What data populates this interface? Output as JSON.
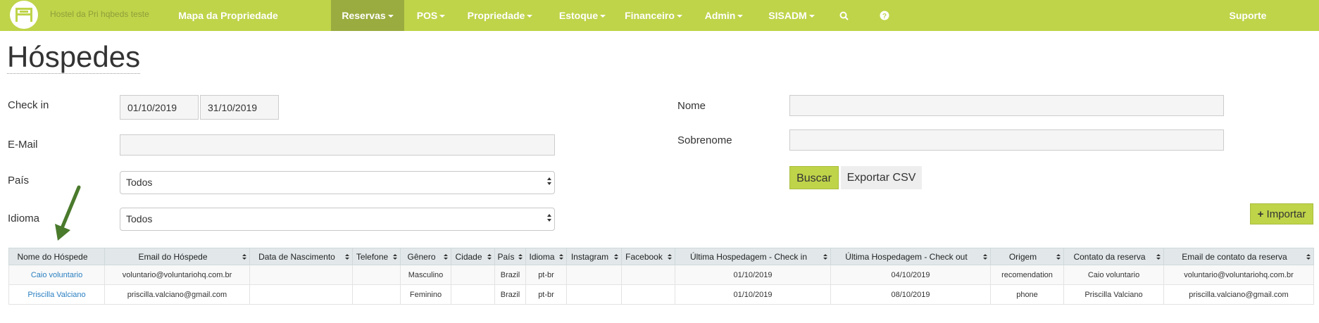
{
  "navbar": {
    "brand": "Hostel da Pri hqbeds teste",
    "items": [
      {
        "label": "Mapa da Propriedade",
        "dropdown": false,
        "active": false
      },
      {
        "label": "Reservas",
        "dropdown": true,
        "active": true
      },
      {
        "label": "POS",
        "dropdown": true,
        "active": false
      },
      {
        "label": "Propriedade",
        "dropdown": true,
        "active": false
      },
      {
        "label": "Estoque",
        "dropdown": true,
        "active": false
      },
      {
        "label": "Financeiro",
        "dropdown": true,
        "active": false
      },
      {
        "label": "Admin",
        "dropdown": true,
        "active": false
      },
      {
        "label": "SISADM",
        "dropdown": true,
        "active": false
      }
    ],
    "support": "Suporte",
    "icons": [
      "search-icon",
      "help-icon"
    ],
    "bg_color": "#bfd449",
    "active_color": "#9aac3f"
  },
  "page": {
    "title": "Hóspedes"
  },
  "form": {
    "checkin_label": "Check in",
    "checkin_from": "01/10/2019",
    "checkin_to": "31/10/2019",
    "email_label": "E-Mail",
    "email_value": "",
    "pais_label": "País",
    "pais_value": "Todos",
    "idioma_label": "Idioma",
    "idioma_value": "Todos",
    "nome_label": "Nome",
    "nome_value": "",
    "sobrenome_label": "Sobrenome",
    "sobrenome_value": "",
    "buscar_label": "Buscar",
    "exportar_label": "Exportar CSV",
    "importar_label": "Importar"
  },
  "table": {
    "columns": [
      "Nome do Hóspede",
      "Email do Hóspede",
      "Data de Nascimento",
      "Telefone",
      "Gênero",
      "Cidade",
      "País",
      "Idioma",
      "Instagram",
      "Facebook",
      "Última Hospedagem - Check in",
      "Última Hospedagem - Check out",
      "Origem",
      "Contato da reserva",
      "Email de contato da reserva"
    ],
    "rows": [
      [
        "Caio voluntario",
        "voluntario@voluntariohq.com.br",
        "",
        "",
        "Masculino",
        "",
        "Brazil",
        "pt-br",
        "",
        "",
        "01/10/2019",
        "04/10/2019",
        "recomendation",
        "Caio voluntario",
        "voluntario@voluntariohq.com.br"
      ],
      [
        "Priscilla Valciano",
        "priscilla.valciano@gmail.com",
        "",
        "",
        "Feminino",
        "",
        "Brazil",
        "pt-br",
        "",
        "",
        "01/10/2019",
        "08/10/2019",
        "phone",
        "Priscilla Valciano",
        "priscilla.valciano@gmail.com"
      ]
    ]
  },
  "annotation_arrow_color": "#4a7a2c"
}
